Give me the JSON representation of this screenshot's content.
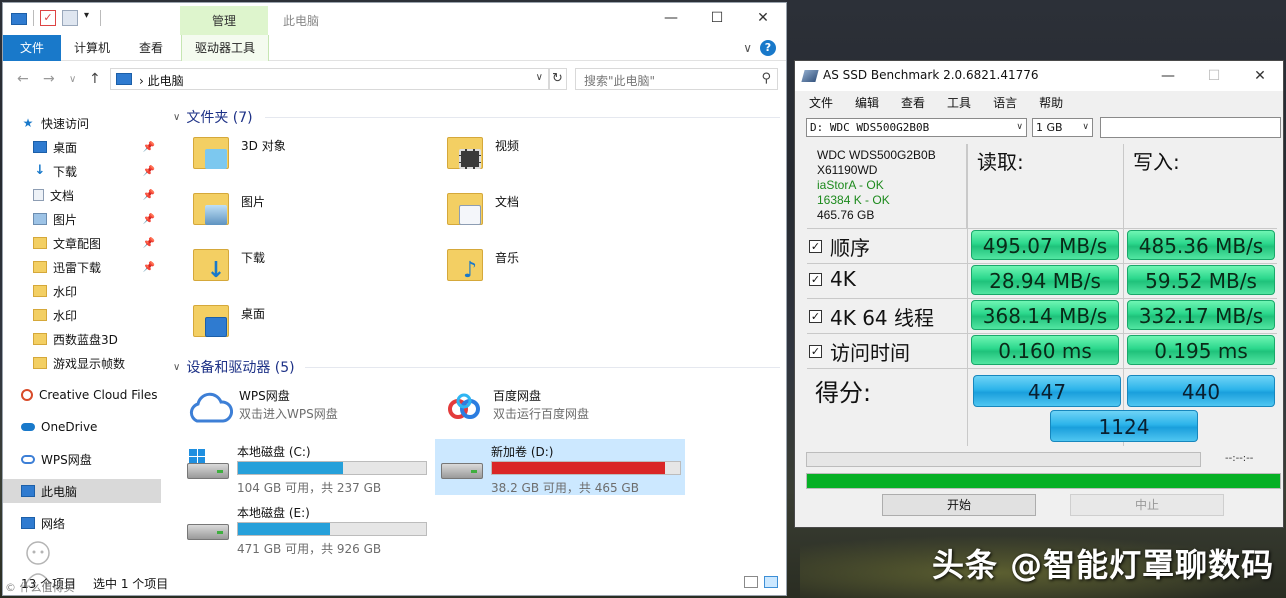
{
  "explorer": {
    "title": "此电脑",
    "context_tab": "管理",
    "ribbon_tabs": [
      "文件",
      "计算机",
      "查看",
      "驱动器工具"
    ],
    "address": "此电脑",
    "search_placeholder": "搜索\"此电脑\"",
    "sidebar": [
      {
        "label": "快速访问",
        "icon": "star-icon",
        "pinned": false
      },
      {
        "label": "桌面",
        "icon": "desktop-icon",
        "pinned": true
      },
      {
        "label": "下载",
        "icon": "download-icon",
        "pinned": true
      },
      {
        "label": "文档",
        "icon": "document-icon",
        "pinned": true
      },
      {
        "label": "图片",
        "icon": "picture-icon",
        "pinned": true
      },
      {
        "label": "文章配图",
        "icon": "folder-icon",
        "pinned": true
      },
      {
        "label": "迅雷下载",
        "icon": "folder-icon",
        "pinned": true
      },
      {
        "label": "水印",
        "icon": "folder-icon",
        "pinned": false
      },
      {
        "label": "水印",
        "icon": "folder-icon",
        "pinned": false
      },
      {
        "label": "西数蓝盘3D",
        "icon": "folder-icon",
        "pinned": false
      },
      {
        "label": "游戏显示帧数",
        "icon": "folder-icon",
        "pinned": false
      },
      {
        "label": "Creative Cloud Files",
        "icon": "creative-cloud-icon",
        "pinned": false
      },
      {
        "label": "OneDrive",
        "icon": "onedrive-icon",
        "pinned": false
      },
      {
        "label": "WPS网盘",
        "icon": "wps-cloud-icon",
        "pinned": false
      },
      {
        "label": "此电脑",
        "icon": "pc-icon",
        "pinned": false
      },
      {
        "label": "网络",
        "icon": "network-icon",
        "pinned": false
      }
    ],
    "folders_heading": "文件夹 (7)",
    "folders": [
      {
        "name": "3D 对象",
        "icon": "3d-objects-icon"
      },
      {
        "name": "视频",
        "icon": "video-icon"
      },
      {
        "name": "图片",
        "icon": "pictures-icon"
      },
      {
        "name": "文档",
        "icon": "documents-icon"
      },
      {
        "name": "下载",
        "icon": "downloads-icon"
      },
      {
        "name": "音乐",
        "icon": "music-icon"
      },
      {
        "name": "桌面",
        "icon": "desktop-icon"
      }
    ],
    "devices_heading": "设备和驱动器 (5)",
    "clouds": [
      {
        "name": "WPS网盘",
        "sub": "双击进入WPS网盘"
      },
      {
        "name": "百度网盘",
        "sub": "双击运行百度网盘"
      }
    ],
    "drives": [
      {
        "name": "本地磁盘 (C:)",
        "sub": "104 GB 可用，共 237 GB",
        "used_fraction": 0.56,
        "color": "#26a0da"
      },
      {
        "name": "新加卷 (D:)",
        "sub": "38.2 GB 可用，共 465 GB",
        "used_fraction": 0.92,
        "color": "#da2626"
      },
      {
        "name": "本地磁盘 (E:)",
        "sub": "471 GB 可用，共 926 GB",
        "used_fraction": 0.49,
        "color": "#26a0da"
      }
    ],
    "status_count": "13 个项目",
    "status_selected": "选中 1 个项目",
    "watermark_small": "© 什么值得买"
  },
  "asssd": {
    "title": "AS SSD Benchmark 2.0.6821.41776",
    "menu": [
      "文件",
      "编辑",
      "查看",
      "工具",
      "语言",
      "帮助"
    ],
    "drive_select": "D: WDC WDS500G2B0B",
    "size_select": "1 GB",
    "info": {
      "model": "WDC WDS500G2B0B",
      "firmware": "X61190WD",
      "driver": "iaStorA - OK",
      "alignment": "16384 K - OK",
      "capacity": "465.76 GB"
    },
    "read_label": "读取:",
    "write_label": "写入:",
    "rows": [
      {
        "label": "顺序",
        "read": "495.07 MB/s",
        "write": "485.36 MB/s"
      },
      {
        "label": "4K",
        "read": "28.94 MB/s",
        "write": "59.52 MB/s"
      },
      {
        "label": "4K 64 线程",
        "read": "368.14 MB/s",
        "write": "332.17 MB/s"
      },
      {
        "label": "访问时间",
        "read": "0.160 ms",
        "write": "0.195 ms"
      }
    ],
    "score_label": "得分:",
    "score_read": "447",
    "score_write": "440",
    "score_total": "1124",
    "time_display": "--:--:--",
    "progress_fraction": 1.0,
    "start_button": "开始",
    "abort_button": "中止",
    "colors": {
      "result_green": "#2bd78c",
      "score_blue": "#2cb4ea",
      "progress_green": "#06b025"
    }
  },
  "watermark": "头条 @智能灯罩聊数码"
}
